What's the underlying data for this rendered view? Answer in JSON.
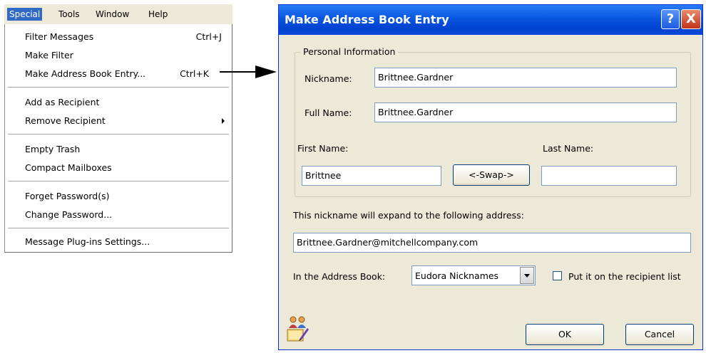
{
  "menubar": {
    "items": [
      {
        "label": "Special",
        "active": true
      },
      {
        "label": "Tools"
      },
      {
        "label": "Window"
      },
      {
        "label": "Help"
      }
    ]
  },
  "dropdown": {
    "items": [
      {
        "label": "Filter Messages",
        "shortcut": "Ctrl+J"
      },
      {
        "label": "Make Filter",
        "shortcut": ""
      },
      {
        "label": "Make Address Book Entry...",
        "shortcut": "Ctrl+K"
      },
      {
        "label": "Add as Recipient",
        "shortcut": ""
      },
      {
        "label": "Remove Recipient",
        "shortcut": "",
        "submenu": true
      },
      {
        "label": "Empty Trash",
        "shortcut": ""
      },
      {
        "label": "Compact Mailboxes",
        "shortcut": ""
      },
      {
        "label": "Forget Password(s)",
        "shortcut": ""
      },
      {
        "label": "Change Password...",
        "shortcut": ""
      },
      {
        "label": "Message Plug-ins Settings...",
        "shortcut": ""
      }
    ]
  },
  "dialog": {
    "title": "Make Address Book Entry",
    "help_button": "?",
    "close_button": "X",
    "group_label": "Personal Information",
    "nickname_label": "Nickname:",
    "nickname_value": "Brittnee.Gardner",
    "fullname_label": "Full Name:",
    "fullname_value": "Brittnee.Gardner",
    "firstname_label": "First Name:",
    "firstname_value": "Brittnee",
    "swap_button": "<-Swap->",
    "lastname_label": "Last Name:",
    "lastname_value": "",
    "expand_label": "This nickname will expand to the following address:",
    "address_value": "Brittnee.Gardner@mitchellcompany.com",
    "addressbook_label": "In the Address Book:",
    "addressbook_value": "Eudora Nicknames",
    "recipient_checkbox_label": "Put it on the recipient list",
    "recipient_checked": false,
    "ok_button": "OK",
    "cancel_button": "Cancel",
    "icon": "address-book-people-icon"
  },
  "colors": {
    "titlebar": "#0a56e0",
    "menu_highlight": "#316ac5",
    "dialog_bg": "#ece9d8"
  }
}
